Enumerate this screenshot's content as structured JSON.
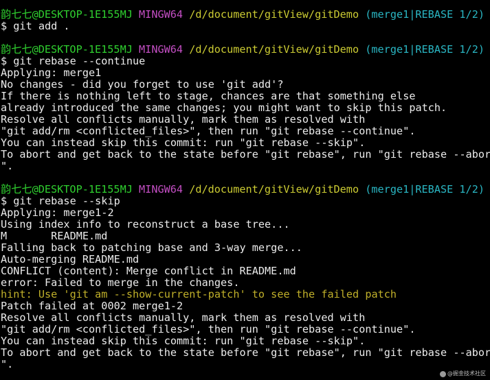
{
  "prompt": {
    "user_host": "韵七七@DESKTOP-1E155MJ",
    "env": "MINGW64",
    "path": "/d/document/gitView/gitDemo",
    "branch": "(merge1|REBASE 1/2)"
  },
  "blocks": [
    {
      "command": "$ git add .",
      "output": []
    },
    {
      "command": "$ git rebase --continue",
      "output": [
        {
          "text": "Applying: merge1",
          "kind": "normal"
        },
        {
          "text": "No changes - did you forget to use 'git add'?",
          "kind": "normal"
        },
        {
          "text": "If there is nothing left to stage, chances are that something else",
          "kind": "normal"
        },
        {
          "text": "already introduced the same changes; you might want to skip this patch.",
          "kind": "normal"
        },
        {
          "text": "Resolve all conflicts manually, mark them as resolved with",
          "kind": "normal"
        },
        {
          "text": "\"git add/rm <conflicted_files>\", then run \"git rebase --continue\".",
          "kind": "normal"
        },
        {
          "text": "You can instead skip this commit: run \"git rebase --skip\".",
          "kind": "normal"
        },
        {
          "text": "To abort and get back to the state before \"git rebase\", run \"git rebase --abort",
          "kind": "normal"
        },
        {
          "text": "\".",
          "kind": "normal"
        }
      ]
    },
    {
      "command": "$ git rebase --skip",
      "output": [
        {
          "text": "Applying: merge1-2",
          "kind": "normal"
        },
        {
          "text": "Using index info to reconstruct a base tree...",
          "kind": "normal"
        },
        {
          "text": "M       README.md",
          "kind": "normal"
        },
        {
          "text": "Falling back to patching base and 3-way merge...",
          "kind": "normal"
        },
        {
          "text": "Auto-merging README.md",
          "kind": "normal"
        },
        {
          "text": "CONFLICT (content): Merge conflict in README.md",
          "kind": "normal"
        },
        {
          "text": "error: Failed to merge in the changes.",
          "kind": "normal"
        },
        {
          "text": "hint: Use 'git am --show-current-patch' to see the failed patch",
          "kind": "hint"
        },
        {
          "text": "Patch failed at 0002 merge1-2",
          "kind": "normal"
        },
        {
          "text": "Resolve all conflicts manually, mark them as resolved with",
          "kind": "normal"
        },
        {
          "text": "\"git add/rm <conflicted_files>\", then run \"git rebase --continue\".",
          "kind": "normal"
        },
        {
          "text": "You can instead skip this commit: run \"git rebase --skip\".",
          "kind": "normal"
        },
        {
          "text": "To abort and get back to the state before \"git rebase\", run \"git rebase --abort",
          "kind": "normal"
        },
        {
          "text": "\".",
          "kind": "normal"
        }
      ]
    }
  ],
  "watermark": "@掘金技术社区",
  "colors": {
    "background": "#000000",
    "text": "#ececec",
    "user_host": "#2fd02f",
    "env": "#c34ec3",
    "path": "#cccc33",
    "branch": "#2ab7c4",
    "hint": "#c0b02a"
  }
}
